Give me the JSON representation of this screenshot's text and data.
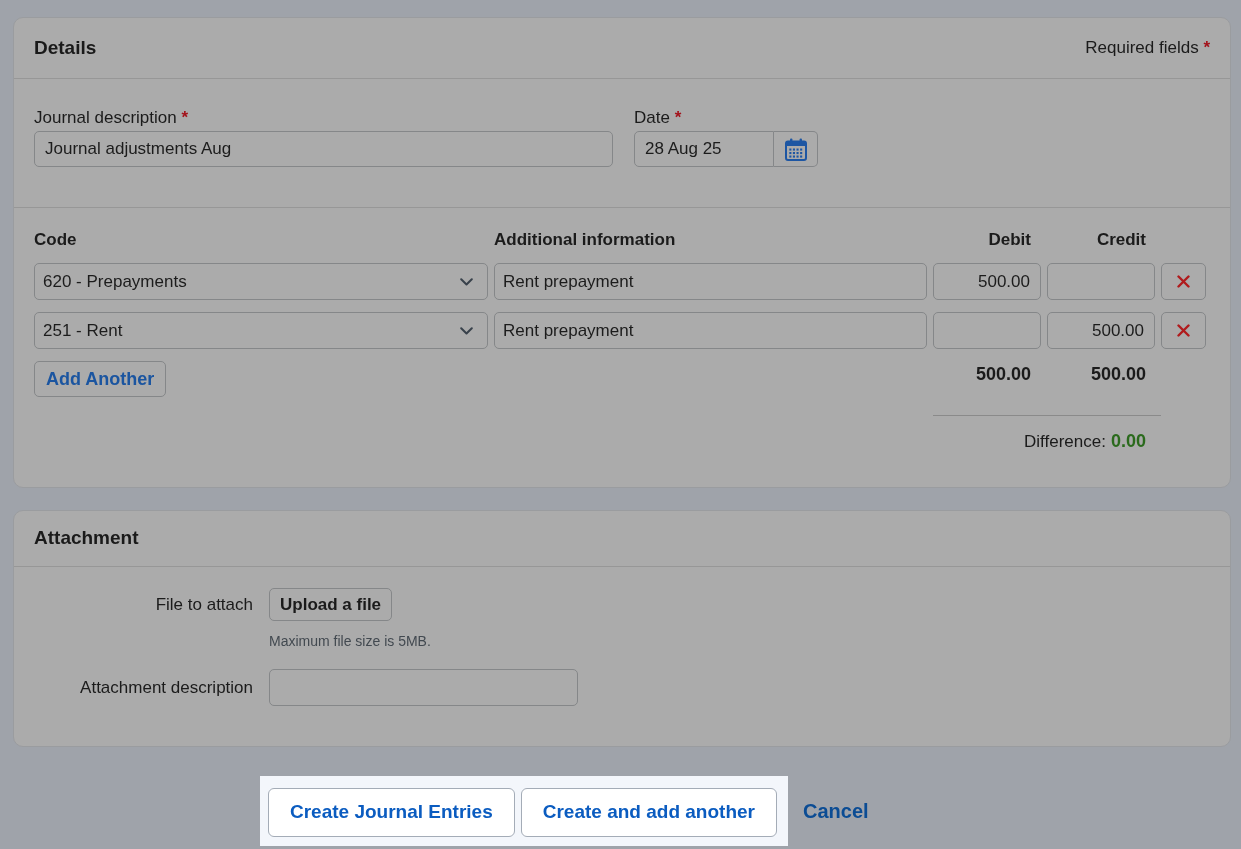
{
  "details": {
    "title": "Details",
    "required_note": {
      "text": "Required fields",
      "mark": "*"
    },
    "fields": [
      {
        "kind": "text",
        "label": "Journal description",
        "required_mark": "*",
        "value": "Journal adjustments Aug"
      },
      {
        "kind": "date",
        "label": "Date",
        "required_mark": "*",
        "value": "28 Aug 25"
      }
    ],
    "lines": {
      "columns": [
        "Code",
        "Additional information",
        "Debit",
        "Credit"
      ],
      "rows": [
        {
          "code": "620 - Prepayments",
          "info": "Rent prepayment",
          "debit": "500.00"
        },
        {
          "code": "251 - Rent",
          "info": "Rent prepayment",
          "credit": "500.00"
        }
      ],
      "add_button": "Add Another",
      "totals": {
        "debit": "500.00",
        "credit": "500.00"
      },
      "difference": {
        "label": "Difference:",
        "value": "0.00"
      }
    }
  },
  "attachment": {
    "title": "Attachment",
    "file_label": "File to attach",
    "upload_button": "Upload a file",
    "hint": "Maximum file size is 5MB.",
    "description_label": "Attachment description"
  },
  "actions": [
    {
      "kind": "button",
      "label": "Create Journal Entries",
      "highlighted": true
    },
    {
      "kind": "button",
      "label": "Create and add another",
      "highlighted": true
    },
    {
      "kind": "link",
      "label": "Cancel",
      "highlighted": false
    }
  ]
}
